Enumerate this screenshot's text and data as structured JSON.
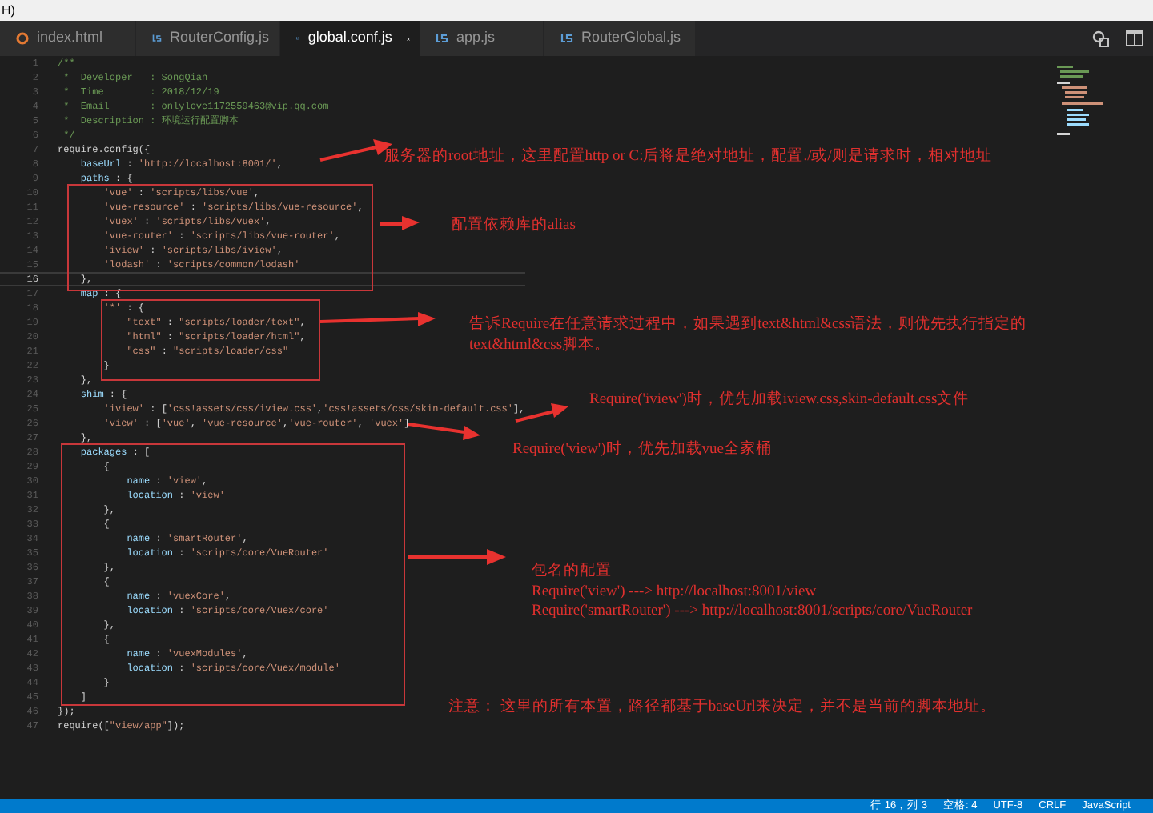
{
  "window_strip": {
    "text": "H)"
  },
  "tabs": [
    {
      "label": "index.html",
      "kind": "html",
      "selected": false
    },
    {
      "label": "RouterConfig.js",
      "kind": "js",
      "selected": false
    },
    {
      "label": "global.conf.js",
      "kind": "js",
      "selected": true
    },
    {
      "label": "app.js",
      "kind": "js",
      "selected": false
    },
    {
      "label": "RouterGlobal.js",
      "kind": "js",
      "selected": false
    }
  ],
  "editor": {
    "lines": [
      {
        "number": "1",
        "current": false,
        "segments": [
          {
            "kind": "comment",
            "text": "/**"
          }
        ]
      },
      {
        "number": "2",
        "current": false,
        "segments": [
          {
            "kind": "comment",
            "text": " *  Developer   : SongQian"
          }
        ]
      },
      {
        "number": "3",
        "current": false,
        "segments": [
          {
            "kind": "comment",
            "text": " *  Time        : 2018/12/19"
          }
        ]
      },
      {
        "number": "4",
        "current": false,
        "segments": [
          {
            "kind": "comment",
            "text": " *  Email       : onlylove1172559463@vip.qq.com"
          }
        ]
      },
      {
        "number": "5",
        "current": false,
        "segments": [
          {
            "kind": "comment",
            "text": " *  Description : 环境运行配置脚本"
          }
        ]
      },
      {
        "number": "6",
        "current": false,
        "segments": [
          {
            "kind": "comment",
            "text": " */"
          }
        ]
      },
      {
        "number": "7",
        "current": false,
        "segments": [
          {
            "kind": "plain",
            "text": "require.config({"
          }
        ]
      },
      {
        "number": "8",
        "current": false,
        "segments": [
          {
            "kind": "key",
            "text": "    baseUrl"
          },
          {
            "kind": "plain",
            "text": " : "
          },
          {
            "kind": "string",
            "text": "'http://localhost:8001/'"
          },
          {
            "kind": "plain",
            "text": ","
          }
        ]
      },
      {
        "number": "9",
        "current": false,
        "segments": [
          {
            "kind": "key",
            "text": "    paths"
          },
          {
            "kind": "plain",
            "text": " : {"
          }
        ]
      },
      {
        "number": "10",
        "current": false,
        "segments": [
          {
            "kind": "string",
            "text": "        'vue'"
          },
          {
            "kind": "plain",
            "text": " : "
          },
          {
            "kind": "string",
            "text": "'scripts/libs/vue'"
          },
          {
            "kind": "plain",
            "text": ","
          }
        ]
      },
      {
        "number": "11",
        "current": false,
        "segments": [
          {
            "kind": "string",
            "text": "        'vue-resource'"
          },
          {
            "kind": "plain",
            "text": " : "
          },
          {
            "kind": "string",
            "text": "'scripts/libs/vue-resource'"
          },
          {
            "kind": "plain",
            "text": ","
          }
        ]
      },
      {
        "number": "12",
        "current": false,
        "segments": [
          {
            "kind": "string",
            "text": "        'vuex'"
          },
          {
            "kind": "plain",
            "text": " : "
          },
          {
            "kind": "string",
            "text": "'scripts/libs/vuex'"
          },
          {
            "kind": "plain",
            "text": ","
          }
        ]
      },
      {
        "number": "13",
        "current": false,
        "segments": [
          {
            "kind": "string",
            "text": "        'vue-router'"
          },
          {
            "kind": "plain",
            "text": " : "
          },
          {
            "kind": "string",
            "text": "'scripts/libs/vue-router'"
          },
          {
            "kind": "plain",
            "text": ","
          }
        ]
      },
      {
        "number": "14",
        "current": false,
        "segments": [
          {
            "kind": "string",
            "text": "        'iview'"
          },
          {
            "kind": "plain",
            "text": " : "
          },
          {
            "kind": "string",
            "text": "'scripts/libs/iview'"
          },
          {
            "kind": "plain",
            "text": ","
          }
        ]
      },
      {
        "number": "15",
        "current": false,
        "segments": [
          {
            "kind": "string",
            "text": "        'lodash'"
          },
          {
            "kind": "plain",
            "text": " : "
          },
          {
            "kind": "string",
            "text": "'scripts/common/lodash'"
          }
        ]
      },
      {
        "number": "16",
        "current": true,
        "segments": [
          {
            "kind": "plain",
            "text": "    },"
          }
        ]
      },
      {
        "number": "17",
        "current": false,
        "segments": [
          {
            "kind": "key",
            "text": "    map"
          },
          {
            "kind": "plain",
            "text": " : {"
          }
        ]
      },
      {
        "number": "18",
        "current": false,
        "segments": [
          {
            "kind": "string",
            "text": "        '*'"
          },
          {
            "kind": "plain",
            "text": " : {"
          }
        ]
      },
      {
        "number": "19",
        "current": false,
        "segments": [
          {
            "kind": "string",
            "text": "            \"text\""
          },
          {
            "kind": "plain",
            "text": " : "
          },
          {
            "kind": "string",
            "text": "\"scripts/loader/text\""
          },
          {
            "kind": "plain",
            "text": ","
          }
        ]
      },
      {
        "number": "20",
        "current": false,
        "segments": [
          {
            "kind": "string",
            "text": "            \"html\""
          },
          {
            "kind": "plain",
            "text": " : "
          },
          {
            "kind": "string",
            "text": "\"scripts/loader/html\""
          },
          {
            "kind": "plain",
            "text": ","
          }
        ]
      },
      {
        "number": "21",
        "current": false,
        "segments": [
          {
            "kind": "string",
            "text": "            \"css\""
          },
          {
            "kind": "plain",
            "text": " : "
          },
          {
            "kind": "string",
            "text": "\"scripts/loader/css\""
          }
        ]
      },
      {
        "number": "22",
        "current": false,
        "segments": [
          {
            "kind": "plain",
            "text": "        }"
          }
        ]
      },
      {
        "number": "23",
        "current": false,
        "segments": [
          {
            "kind": "plain",
            "text": "    },"
          }
        ]
      },
      {
        "number": "24",
        "current": false,
        "segments": [
          {
            "kind": "key",
            "text": "    shim"
          },
          {
            "kind": "plain",
            "text": " : {"
          }
        ]
      },
      {
        "number": "25",
        "current": false,
        "segments": [
          {
            "kind": "string",
            "text": "        'iview'"
          },
          {
            "kind": "plain",
            "text": " : ["
          },
          {
            "kind": "string",
            "text": "'css!assets/css/iview.css'"
          },
          {
            "kind": "plain",
            "text": ","
          },
          {
            "kind": "string",
            "text": "'css!assets/css/skin-default.css'"
          },
          {
            "kind": "plain",
            "text": "],"
          }
        ]
      },
      {
        "number": "26",
        "current": false,
        "segments": [
          {
            "kind": "string",
            "text": "        'view'"
          },
          {
            "kind": "plain",
            "text": " : ["
          },
          {
            "kind": "string",
            "text": "'vue'"
          },
          {
            "kind": "plain",
            "text": ", "
          },
          {
            "kind": "string",
            "text": "'vue-resource'"
          },
          {
            "kind": "plain",
            "text": ","
          },
          {
            "kind": "string",
            "text": "'vue-router'"
          },
          {
            "kind": "plain",
            "text": ", "
          },
          {
            "kind": "string",
            "text": "'vuex'"
          },
          {
            "kind": "plain",
            "text": "]"
          }
        ]
      },
      {
        "number": "27",
        "current": false,
        "segments": [
          {
            "kind": "plain",
            "text": "    },"
          }
        ]
      },
      {
        "number": "28",
        "current": false,
        "segments": [
          {
            "kind": "key",
            "text": "    packages"
          },
          {
            "kind": "plain",
            "text": " : ["
          }
        ]
      },
      {
        "number": "29",
        "current": false,
        "segments": [
          {
            "kind": "plain",
            "text": "        {"
          }
        ]
      },
      {
        "number": "30",
        "current": false,
        "segments": [
          {
            "kind": "key",
            "text": "            name"
          },
          {
            "kind": "plain",
            "text": " : "
          },
          {
            "kind": "string",
            "text": "'view'"
          },
          {
            "kind": "plain",
            "text": ","
          }
        ]
      },
      {
        "number": "31",
        "current": false,
        "segments": [
          {
            "kind": "key",
            "text": "            location"
          },
          {
            "kind": "plain",
            "text": " : "
          },
          {
            "kind": "string",
            "text": "'view'"
          }
        ]
      },
      {
        "number": "32",
        "current": false,
        "segments": [
          {
            "kind": "plain",
            "text": "        },"
          }
        ]
      },
      {
        "number": "33",
        "current": false,
        "segments": [
          {
            "kind": "plain",
            "text": "        {"
          }
        ]
      },
      {
        "number": "34",
        "current": false,
        "segments": [
          {
            "kind": "key",
            "text": "            name"
          },
          {
            "kind": "plain",
            "text": " : "
          },
          {
            "kind": "string",
            "text": "'smartRouter'"
          },
          {
            "kind": "plain",
            "text": ","
          }
        ]
      },
      {
        "number": "35",
        "current": false,
        "segments": [
          {
            "kind": "key",
            "text": "            location"
          },
          {
            "kind": "plain",
            "text": " : "
          },
          {
            "kind": "string",
            "text": "'scripts/core/VueRouter'"
          }
        ]
      },
      {
        "number": "36",
        "current": false,
        "segments": [
          {
            "kind": "plain",
            "text": "        },"
          }
        ]
      },
      {
        "number": "37",
        "current": false,
        "segments": [
          {
            "kind": "plain",
            "text": "        {"
          }
        ]
      },
      {
        "number": "38",
        "current": false,
        "segments": [
          {
            "kind": "key",
            "text": "            name"
          },
          {
            "kind": "plain",
            "text": " : "
          },
          {
            "kind": "string",
            "text": "'vuexCore'"
          },
          {
            "kind": "plain",
            "text": ","
          }
        ]
      },
      {
        "number": "39",
        "current": false,
        "segments": [
          {
            "kind": "key",
            "text": "            location"
          },
          {
            "kind": "plain",
            "text": " : "
          },
          {
            "kind": "string",
            "text": "'scripts/core/Vuex/core'"
          }
        ]
      },
      {
        "number": "40",
        "current": false,
        "segments": [
          {
            "kind": "plain",
            "text": "        },"
          }
        ]
      },
      {
        "number": "41",
        "current": false,
        "segments": [
          {
            "kind": "plain",
            "text": "        {"
          }
        ]
      },
      {
        "number": "42",
        "current": false,
        "segments": [
          {
            "kind": "key",
            "text": "            name"
          },
          {
            "kind": "plain",
            "text": " : "
          },
          {
            "kind": "string",
            "text": "'vuexModules'"
          },
          {
            "kind": "plain",
            "text": ","
          }
        ]
      },
      {
        "number": "43",
        "current": false,
        "segments": [
          {
            "kind": "key",
            "text": "            location"
          },
          {
            "kind": "plain",
            "text": " : "
          },
          {
            "kind": "string",
            "text": "'scripts/core/Vuex/module'"
          }
        ]
      },
      {
        "number": "44",
        "current": false,
        "segments": [
          {
            "kind": "plain",
            "text": "        }"
          }
        ]
      },
      {
        "number": "45",
        "current": false,
        "segments": [
          {
            "kind": "plain",
            "text": "    ]"
          }
        ]
      },
      {
        "number": "46",
        "current": false,
        "segments": [
          {
            "kind": "plain",
            "text": "});"
          }
        ]
      },
      {
        "number": "47",
        "current": false,
        "segments": [
          {
            "kind": "plain",
            "text": "require(["
          },
          {
            "kind": "string",
            "text": "\"view/app\""
          },
          {
            "kind": "plain",
            "text": "]);"
          }
        ]
      }
    ]
  },
  "annotations": [
    {
      "lines": [
        "服务器的root地址，这里配置http or C:后将是绝对地址，配置./或/则是请求时，相对地址"
      ]
    },
    {
      "lines": [
        "配置依赖库的alias"
      ]
    },
    {
      "lines": [
        "告诉Require在任意请求过程中，如果遇到text&html&css语法，则优先执行指定的",
        "text&html&css脚本。"
      ]
    },
    {
      "lines": [
        "Require('iview')时，优先加载iview.css,skin-default.css文件"
      ]
    },
    {
      "lines": [
        "Require('view')时，优先加载vue全家桶"
      ]
    },
    {
      "lines": [
        "包名的配置",
        "Require('view') ---> http://localhost:8001/view",
        "Require('smartRouter') ---> http://localhost:8001/scripts/core/VueRouter"
      ]
    },
    {
      "lines": [
        "注意： 这里的所有本置，路径都基于baseUrl来决定，并不是当前的脚本地址。"
      ]
    }
  ],
  "status_bar": [
    "行 16，列 3",
    "空格: 4",
    "UTF-8",
    "CRLF",
    "JavaScript"
  ]
}
